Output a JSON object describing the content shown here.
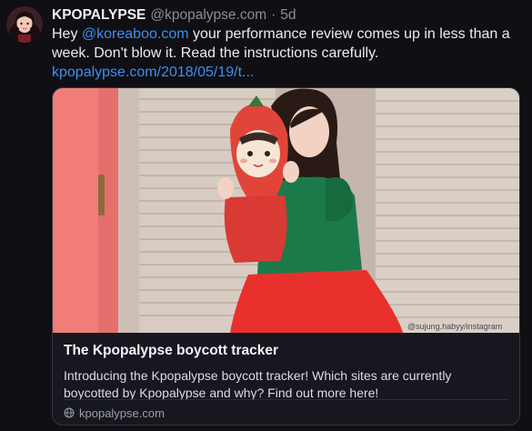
{
  "tweet": {
    "display_name": "KPOPALYPSE",
    "handle": "@kpopalypse.com",
    "separator": "·",
    "time": "5d",
    "text_prefix": "Hey ",
    "mention": "@koreaboo.com",
    "text_line1_rest": " your performance review comes up in less than a week. Don't blow it. Read the instructions carefully.",
    "link": "kpopalypse.com/2018/05/19/t..."
  },
  "card": {
    "title": "The Kpopalypse boycott tracker",
    "description": "Introducing the Kpopalypse boycott tracker!  Which sites are currently boycotted by Kpopalypse and why? Find out more here!",
    "domain": "kpopalypse.com",
    "domain_icon": "globe-icon",
    "image_watermark": "@sujung.habyy/instagram"
  },
  "colors": {
    "background": "#0f0f14",
    "link": "#3f8ff0",
    "muted": "#8b8d99"
  }
}
